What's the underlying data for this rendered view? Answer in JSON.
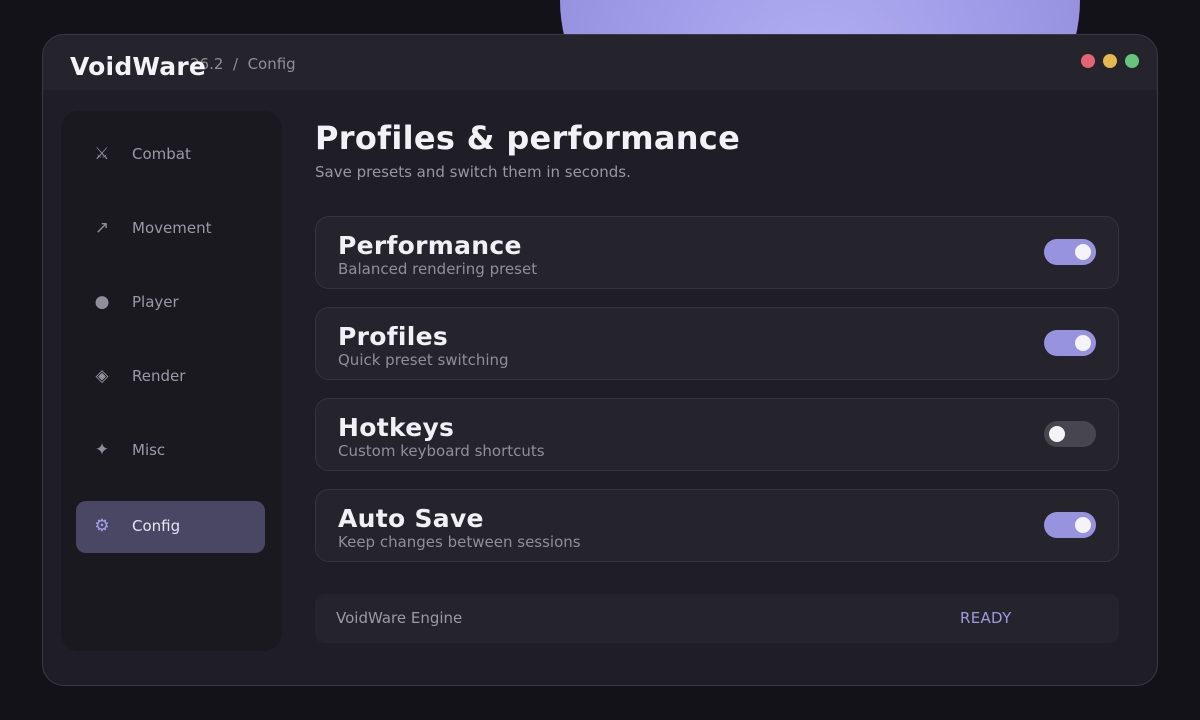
{
  "app": {
    "name": "VoidWare",
    "breadcrumb_version": "26.2",
    "breadcrumb_separator": "/",
    "breadcrumb_page": "Config"
  },
  "window_controls": {
    "colors": {
      "close": "#e46374",
      "minimize": "#e4b750",
      "maximize": "#66c47d"
    }
  },
  "sidebar": {
    "items": [
      {
        "label": "Combat",
        "icon": "sword-icon",
        "glyph": "⚔",
        "active": false
      },
      {
        "label": "Movement",
        "icon": "arrow-icon",
        "glyph": "↗",
        "active": false
      },
      {
        "label": "Player",
        "icon": "circle-icon",
        "glyph": "●",
        "active": false
      },
      {
        "label": "Render",
        "icon": "diamond-icon",
        "glyph": "◈",
        "active": false
      },
      {
        "label": "Misc",
        "icon": "sparkle-icon",
        "glyph": "✦",
        "active": false
      },
      {
        "label": "Config",
        "icon": "gear-icon",
        "glyph": "⚙",
        "active": true
      }
    ]
  },
  "main": {
    "title": "Profiles & performance",
    "subtitle": "Save presets and switch them in seconds.",
    "settings": [
      {
        "title": "Performance",
        "description": "Balanced rendering preset",
        "enabled": true
      },
      {
        "title": "Profiles",
        "description": "Quick preset switching",
        "enabled": true
      },
      {
        "title": "Hotkeys",
        "description": "Custom keyboard shortcuts",
        "enabled": false
      },
      {
        "title": "Auto Save",
        "description": "Keep changes between sessions",
        "enabled": true
      }
    ]
  },
  "footer": {
    "engine_label": "VoidWare Engine",
    "status": "READY"
  },
  "colors": {
    "accent": "#9893de",
    "toggle_off": "#464550",
    "active_nav": "#4a4764",
    "status": "#9e9ae2"
  }
}
